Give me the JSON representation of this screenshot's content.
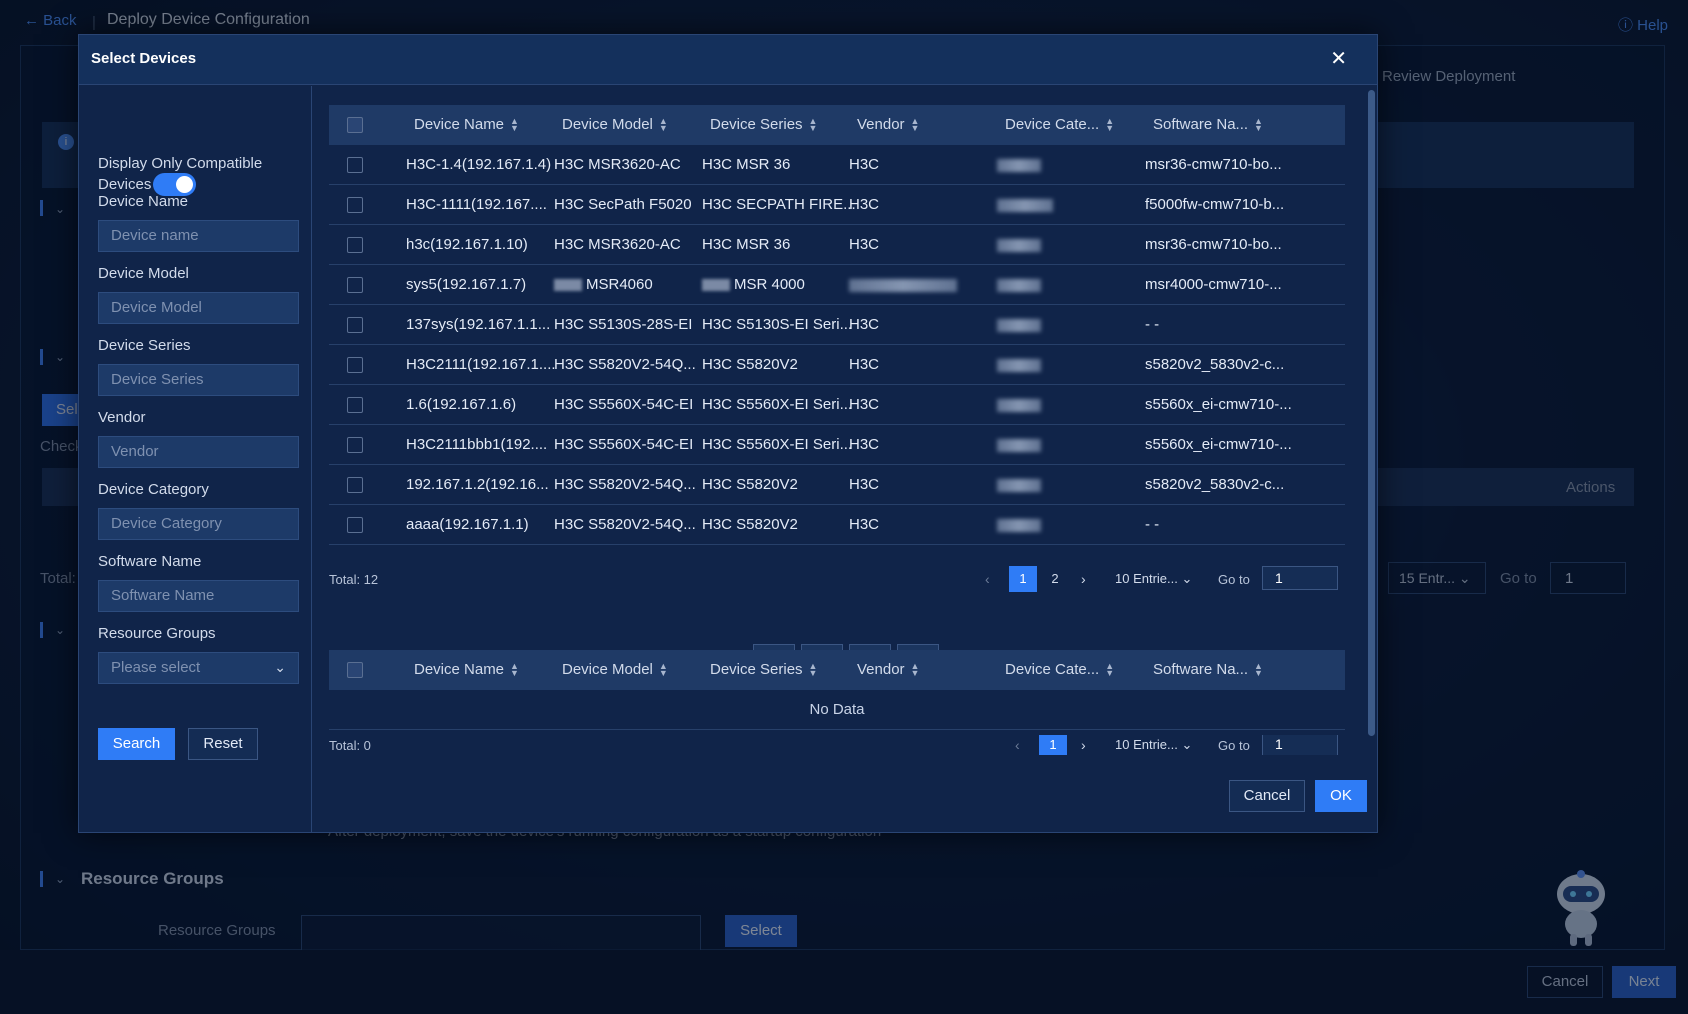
{
  "page": {
    "back_label": "Back",
    "title": "Deploy Device Configuration",
    "help_label": "Help",
    "step_label": "Review Deployment",
    "select_label": "Sel",
    "check_label": "Check",
    "actions_header": "Actions",
    "total_label": "Total:",
    "entries_value": "15 Entr...",
    "goto_label": "Go to",
    "goto_value": "1",
    "after_deploy_text": "After deployment, save the device's running configuration as a startup configuration",
    "resource_groups_title": "Resource Groups",
    "resource_groups_label": "Resource Groups",
    "resource_groups_select": "Select",
    "cancel_label": "Cancel",
    "next_label": "Next"
  },
  "modal": {
    "title": "Select Devices",
    "close_icon": "close-icon",
    "filters": {
      "compat_label": "Display Only Compatible Devices",
      "compat_on": true,
      "device_name_label": "Device Name",
      "device_name_placeholder": "Device name",
      "device_model_label": "Device Model",
      "device_model_placeholder": "Device Model",
      "device_series_label": "Device Series",
      "device_series_placeholder": "Device Series",
      "vendor_label": "Vendor",
      "vendor_placeholder": "Vendor",
      "device_category_label": "Device Category",
      "device_category_placeholder": "Device Category",
      "software_name_label": "Software Name",
      "software_name_placeholder": "Software Name",
      "resource_groups_label": "Resource Groups",
      "resource_groups_placeholder": "Please select",
      "search_label": "Search",
      "reset_label": "Reset"
    },
    "columns": [
      "Device Name",
      "Device Model",
      "Device Series",
      "Vendor",
      "Device Cate...",
      "Software Na..."
    ],
    "rows": [
      {
        "name": "H3C-1.4(192.167.1.4)",
        "model": "H3C MSR3620-AC",
        "series": "H3C MSR 36",
        "vendor": "H3C",
        "software": "msr36-cmw710-bo..."
      },
      {
        "name": "H3C-1111(192.167....",
        "model": "H3C SecPath F5020",
        "series": "H3C SECPATH FIRE...",
        "vendor": "H3C",
        "software": "f5000fw-cmw710-b..."
      },
      {
        "name": "h3c(192.167.1.10)",
        "model": "H3C MSR3620-AC",
        "series": "H3C MSR 36",
        "vendor": "H3C",
        "software": "msr36-cmw710-bo..."
      },
      {
        "name": "sys5(192.167.1.7)",
        "model": "MSR4060",
        "series": "MSR 4000",
        "vendor": "",
        "software": "msr4000-cmw710-..."
      },
      {
        "name": "137sys(192.167.1.1...",
        "model": "H3C S5130S-28S-EI",
        "series": "H3C S5130S-EI Seri...",
        "vendor": "H3C",
        "software": "- -"
      },
      {
        "name": "H3C2111(192.167.1....",
        "model": "H3C S5820V2-54Q...",
        "series": "H3C S5820V2",
        "vendor": "H3C",
        "software": "s5820v2_5830v2-c..."
      },
      {
        "name": "1.6(192.167.1.6)",
        "model": "H3C S5560X-54C-EI",
        "series": "H3C S5560X-EI Seri...",
        "vendor": "H3C",
        "software": "s5560x_ei-cmw710-..."
      },
      {
        "name": "H3C2111bbb1(192....",
        "model": "H3C S5560X-54C-EI",
        "series": "H3C S5560X-EI Seri...",
        "vendor": "H3C",
        "software": "s5560x_ei-cmw710-..."
      },
      {
        "name": "192.167.1.2(192.16...",
        "model": "H3C S5820V2-54Q...",
        "series": "H3C S5820V2",
        "vendor": "H3C",
        "software": "s5820v2_5830v2-c..."
      },
      {
        "name": "aaaa(192.167.1.1)",
        "model": "H3C S5820V2-54Q...",
        "series": "H3C S5820V2",
        "vendor": "H3C",
        "software": "- -"
      }
    ],
    "pager_top": {
      "total": "Total: 12",
      "pages": [
        "1",
        "2"
      ],
      "size": "10 Entrie...",
      "goto_label": "Go to",
      "goto_value": "1"
    },
    "movers": [
      "move-all-down-icon",
      "move-down-icon",
      "move-up-icon",
      "move-all-up-icon"
    ],
    "selected_table": {
      "no_data": "No Data"
    },
    "pager_bottom": {
      "total": "Total: 0",
      "pages": [
        "1"
      ],
      "size": "10 Entrie...",
      "goto_label": "Go to",
      "goto_value": "1"
    },
    "cancel_label": "Cancel",
    "ok_label": "OK"
  }
}
